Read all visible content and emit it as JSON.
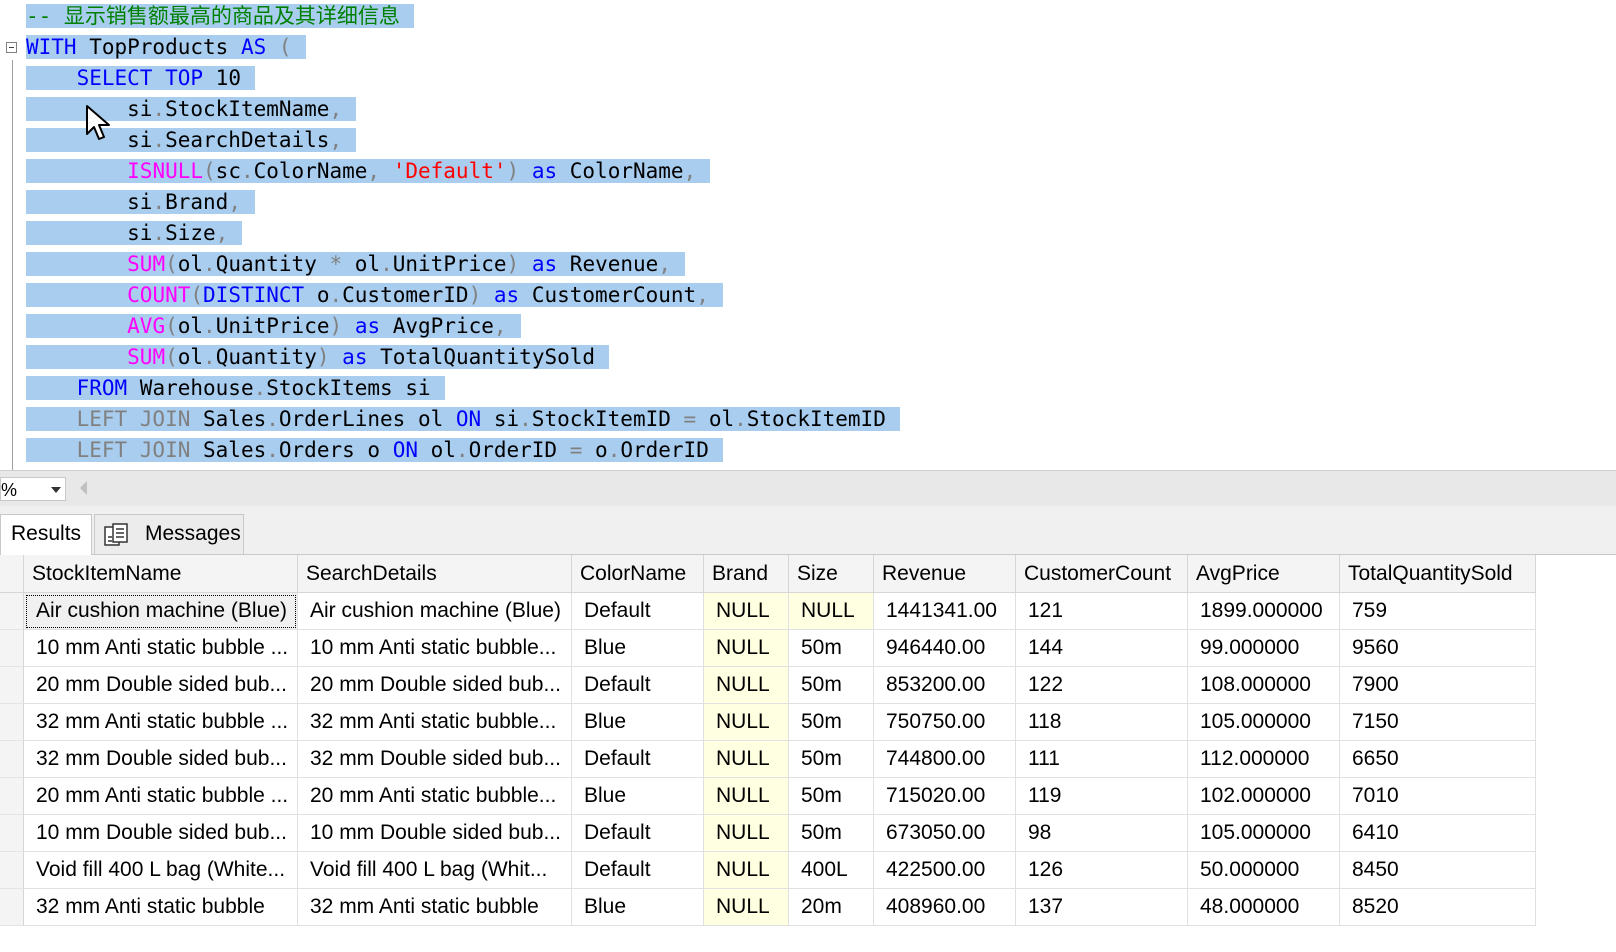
{
  "editor": {
    "lines": [
      [
        {
          "t": "-- 显示销售额最高的商品及其详细信息",
          "c": "cm"
        }
      ],
      [
        {
          "t": "WITH",
          "c": "kw"
        },
        {
          "t": " TopProducts "
        },
        {
          "t": "AS",
          "c": "kw"
        },
        {
          "t": " (",
          "c": "op"
        }
      ],
      [
        {
          "t": "    "
        },
        {
          "t": "SELECT",
          "c": "kw"
        },
        {
          "t": " "
        },
        {
          "t": "TOP",
          "c": "kw"
        },
        {
          "t": " 10"
        }
      ],
      [
        {
          "t": "        si"
        },
        {
          "t": ".",
          "c": "op"
        },
        {
          "t": "StockItemName"
        },
        {
          "t": ",",
          "c": "op"
        }
      ],
      [
        {
          "t": "        si"
        },
        {
          "t": ".",
          "c": "op"
        },
        {
          "t": "SearchDetails"
        },
        {
          "t": ",",
          "c": "op"
        }
      ],
      [
        {
          "t": "        "
        },
        {
          "t": "ISNULL",
          "c": "fn"
        },
        {
          "t": "(",
          "c": "op"
        },
        {
          "t": "sc"
        },
        {
          "t": ".",
          "c": "op"
        },
        {
          "t": "ColorName"
        },
        {
          "t": ", ",
          "c": "op"
        },
        {
          "t": "'Default'",
          "c": "str"
        },
        {
          "t": ")",
          "c": "op"
        },
        {
          "t": " "
        },
        {
          "t": "as",
          "c": "kw"
        },
        {
          "t": " ColorName"
        },
        {
          "t": ",",
          "c": "op"
        }
      ],
      [
        {
          "t": "        si"
        },
        {
          "t": ".",
          "c": "op"
        },
        {
          "t": "Brand"
        },
        {
          "t": ",",
          "c": "op"
        }
      ],
      [
        {
          "t": "        si"
        },
        {
          "t": ".",
          "c": "op"
        },
        {
          "t": "Size"
        },
        {
          "t": ",",
          "c": "op"
        }
      ],
      [
        {
          "t": "        "
        },
        {
          "t": "SUM",
          "c": "fn"
        },
        {
          "t": "(",
          "c": "op"
        },
        {
          "t": "ol"
        },
        {
          "t": ".",
          "c": "op"
        },
        {
          "t": "Quantity "
        },
        {
          "t": "*",
          "c": "op"
        },
        {
          "t": " ol"
        },
        {
          "t": ".",
          "c": "op"
        },
        {
          "t": "UnitPrice"
        },
        {
          "t": ")",
          "c": "op"
        },
        {
          "t": " "
        },
        {
          "t": "as",
          "c": "kw"
        },
        {
          "t": " Revenue"
        },
        {
          "t": ",",
          "c": "op"
        }
      ],
      [
        {
          "t": "        "
        },
        {
          "t": "COUNT",
          "c": "fn"
        },
        {
          "t": "(",
          "c": "op"
        },
        {
          "t": "DISTINCT",
          "c": "kw"
        },
        {
          "t": " o"
        },
        {
          "t": ".",
          "c": "op"
        },
        {
          "t": "CustomerID"
        },
        {
          "t": ")",
          "c": "op"
        },
        {
          "t": " "
        },
        {
          "t": "as",
          "c": "kw"
        },
        {
          "t": " CustomerCount"
        },
        {
          "t": ",",
          "c": "op"
        }
      ],
      [
        {
          "t": "        "
        },
        {
          "t": "AVG",
          "c": "fn"
        },
        {
          "t": "(",
          "c": "op"
        },
        {
          "t": "ol"
        },
        {
          "t": ".",
          "c": "op"
        },
        {
          "t": "UnitPrice"
        },
        {
          "t": ")",
          "c": "op"
        },
        {
          "t": " "
        },
        {
          "t": "as",
          "c": "kw"
        },
        {
          "t": " AvgPrice"
        },
        {
          "t": ",",
          "c": "op"
        }
      ],
      [
        {
          "t": "        "
        },
        {
          "t": "SUM",
          "c": "fn"
        },
        {
          "t": "(",
          "c": "op"
        },
        {
          "t": "ol"
        },
        {
          "t": ".",
          "c": "op"
        },
        {
          "t": "Quantity"
        },
        {
          "t": ")",
          "c": "op"
        },
        {
          "t": " "
        },
        {
          "t": "as",
          "c": "kw"
        },
        {
          "t": " TotalQuantitySold"
        }
      ],
      [
        {
          "t": "    "
        },
        {
          "t": "FROM",
          "c": "kw"
        },
        {
          "t": " Warehouse"
        },
        {
          "t": ".",
          "c": "op"
        },
        {
          "t": "StockItems si"
        }
      ],
      [
        {
          "t": "    "
        },
        {
          "t": "LEFT JOIN",
          "c": "jn"
        },
        {
          "t": " Sales"
        },
        {
          "t": ".",
          "c": "op"
        },
        {
          "t": "OrderLines ol "
        },
        {
          "t": "ON",
          "c": "kw"
        },
        {
          "t": " si"
        },
        {
          "t": ".",
          "c": "op"
        },
        {
          "t": "StockItemID "
        },
        {
          "t": "=",
          "c": "op"
        },
        {
          "t": " ol"
        },
        {
          "t": ".",
          "c": "op"
        },
        {
          "t": "StockItemID"
        }
      ],
      [
        {
          "t": "    "
        },
        {
          "t": "LEFT JOIN",
          "c": "jn"
        },
        {
          "t": " Sales"
        },
        {
          "t": ".",
          "c": "op"
        },
        {
          "t": "Orders o "
        },
        {
          "t": "ON",
          "c": "kw"
        },
        {
          "t": " ol"
        },
        {
          "t": ".",
          "c": "op"
        },
        {
          "t": "OrderID "
        },
        {
          "t": "=",
          "c": "op"
        },
        {
          "t": " o"
        },
        {
          "t": ".",
          "c": "op"
        },
        {
          "t": "OrderID"
        }
      ]
    ]
  },
  "zoom": {
    "value": "%"
  },
  "tabs": {
    "results_label": "Results",
    "messages_label": "Messages",
    "messages_icon": "messages-icon"
  },
  "grid": {
    "columns": [
      "StockItemName",
      "SearchDetails",
      "ColorName",
      "Brand",
      "Size",
      "Revenue",
      "CustomerCount",
      "AvgPrice",
      "TotalQuantitySold"
    ],
    "rows": [
      [
        "Air cushion machine (Blue)",
        "Air cushion machine (Blue)",
        "Default",
        "NULL",
        "NULL",
        "1441341.00",
        "121",
        "1899.000000",
        "759"
      ],
      [
        "10 mm Anti static bubble ...",
        "10 mm Anti static bubble...",
        "Blue",
        "NULL",
        "50m",
        "946440.00",
        "144",
        "99.000000",
        "9560"
      ],
      [
        "20 mm Double sided bub...",
        "20 mm Double sided bub...",
        "Default",
        "NULL",
        "50m",
        "853200.00",
        "122",
        "108.000000",
        "7900"
      ],
      [
        "32 mm Anti static bubble ...",
        "32 mm Anti static bubble...",
        "Blue",
        "NULL",
        "50m",
        "750750.00",
        "118",
        "105.000000",
        "7150"
      ],
      [
        "32 mm Double sided bub...",
        "32 mm Double sided bub...",
        "Default",
        "NULL",
        "50m",
        "744800.00",
        "111",
        "112.000000",
        "6650"
      ],
      [
        "20 mm Anti static bubble ...",
        "20 mm Anti static bubble...",
        "Blue",
        "NULL",
        "50m",
        "715020.00",
        "119",
        "102.000000",
        "7010"
      ],
      [
        "10 mm Double sided bub...",
        "10 mm Double sided bub...",
        "Default",
        "NULL",
        "50m",
        "673050.00",
        "98",
        "105.000000",
        "6410"
      ],
      [
        "Void fill 400 L bag (White...",
        "Void fill 400 L bag (Whit...",
        "Default",
        "NULL",
        "400L",
        "422500.00",
        "126",
        "50.000000",
        "8450"
      ],
      [
        "32 mm Anti static bubble",
        "32 mm Anti static bubble",
        "Blue",
        "NULL",
        "20m",
        "408960.00",
        "137",
        "48.000000",
        "8520"
      ]
    ]
  },
  "colors": {
    "selection": "#a9cdef",
    "keyword": "#0000ff",
    "function": "#ff00ff",
    "string": "#ff0000",
    "comment": "#008000",
    "null_cell": "#ffffe1"
  }
}
